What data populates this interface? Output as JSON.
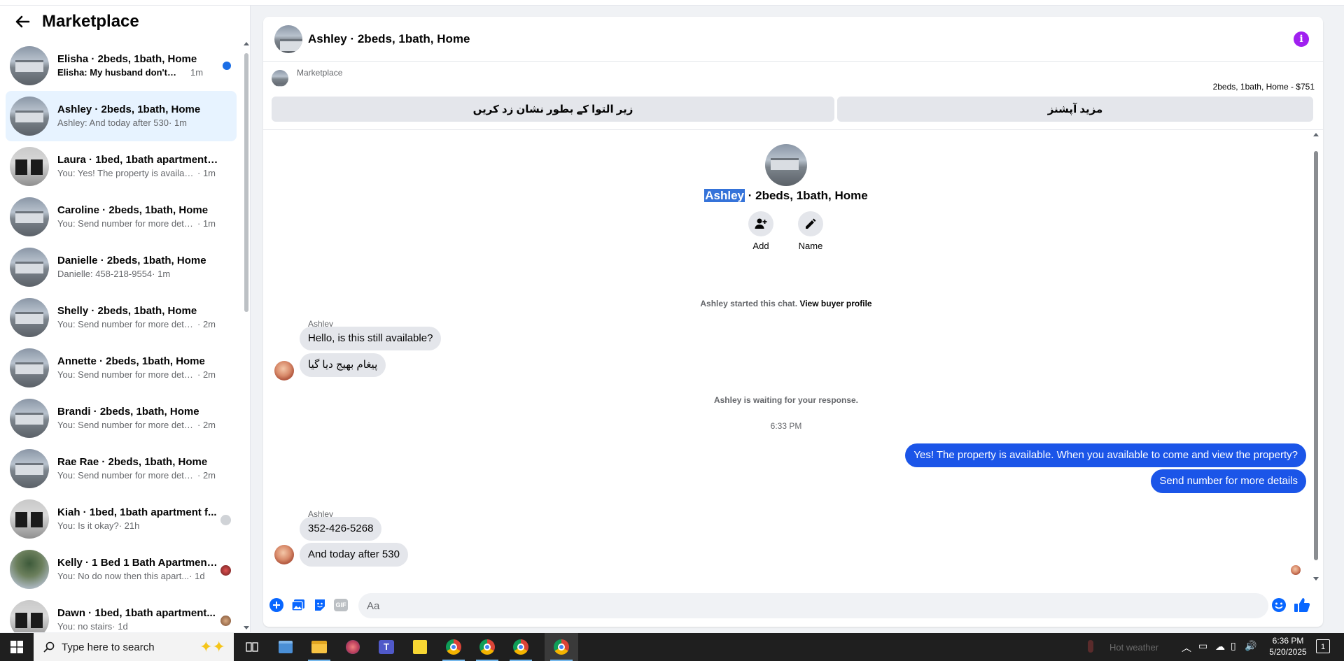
{
  "sidebar": {
    "title": "Marketplace",
    "conversations": [
      {
        "name": "Elisha · 2beds, 1bath, Home",
        "preview": "Elisha: My husband don't get o...",
        "time": "1m",
        "unread": true
      },
      {
        "name": "Ashley · 2beds, 1bath, Home",
        "preview": "Ashley: And today after 530",
        "time": "· 1m",
        "active": true
      },
      {
        "name": "Laura · 1bed, 1bath apartment fo...",
        "preview": "You: Yes! The property is available. ...",
        "time": "· 1m"
      },
      {
        "name": "Caroline · 2beds, 1bath, Home",
        "preview": "You: Send number for more details",
        "time": "· 1m"
      },
      {
        "name": "Danielle · 2beds, 1bath, Home",
        "preview": "Danielle: 458-218-9554",
        "time": "· 1m"
      },
      {
        "name": "Shelly · 2beds, 1bath, Home",
        "preview": "You: Send number for more details",
        "time": "· 2m"
      },
      {
        "name": "Annette · 2beds, 1bath, Home",
        "preview": "You: Send number for more details",
        "time": "· 2m"
      },
      {
        "name": "Brandi · 2beds, 1bath, Home",
        "preview": "You: Send number for more details",
        "time": "· 2m"
      },
      {
        "name": "Rae Rae · 2beds, 1bath, Home",
        "preview": "You: Send number for more details",
        "time": "· 2m"
      },
      {
        "name": "Kiah · 1bed, 1bath apartment f...",
        "preview": "You: Is it okay?",
        "time": "· 21h"
      },
      {
        "name": "Kelly · 1 Bed 1 Bath Apartment...",
        "preview": "You: No do now then this apart...",
        "time": "· 1d"
      },
      {
        "name": "Dawn · 1bed, 1bath apartment...",
        "preview": "You: no stairs",
        "time": "· 1d"
      }
    ]
  },
  "chat": {
    "title": "Ashley · 2beds, 1bath, Home",
    "marketplace_label": "Marketplace",
    "listing_price": "2beds, 1bath, Home - $751",
    "btn_left": "زیر التوا کے بطور نشان زد کریں",
    "btn_right": "مزید آپشنز",
    "intro_name": "Ashley",
    "intro_rest": " · 2beds, 1bath, Home",
    "add_label": "Add",
    "name_label": "Name",
    "started_text": "Ashley started this chat.",
    "view_profile": "View buyer profile",
    "sender1": "Ashley",
    "msg1": "Hello, is this still available?",
    "msg2": "پیغام بھیج دیا گیا",
    "waiting": "Ashley is waiting for your response.",
    "timestamp": "6:33 PM",
    "out1": "Yes! The property is available. When you available to come and view the property?",
    "out2": "Send number for more details",
    "sender2": "Ashley",
    "msg3": "352-426-5268",
    "msg4": "And today after 530",
    "input_placeholder": "Aa",
    "gif_label": "GIF"
  },
  "taskbar": {
    "search_placeholder": "Type here to search",
    "weather": "Hot weather",
    "time": "6:36 PM",
    "date": "5/20/2025",
    "notif_count": "1"
  },
  "colors": {
    "accent": "#1b55e8",
    "info": "#a020f0",
    "active_row": "#e7f3ff"
  }
}
